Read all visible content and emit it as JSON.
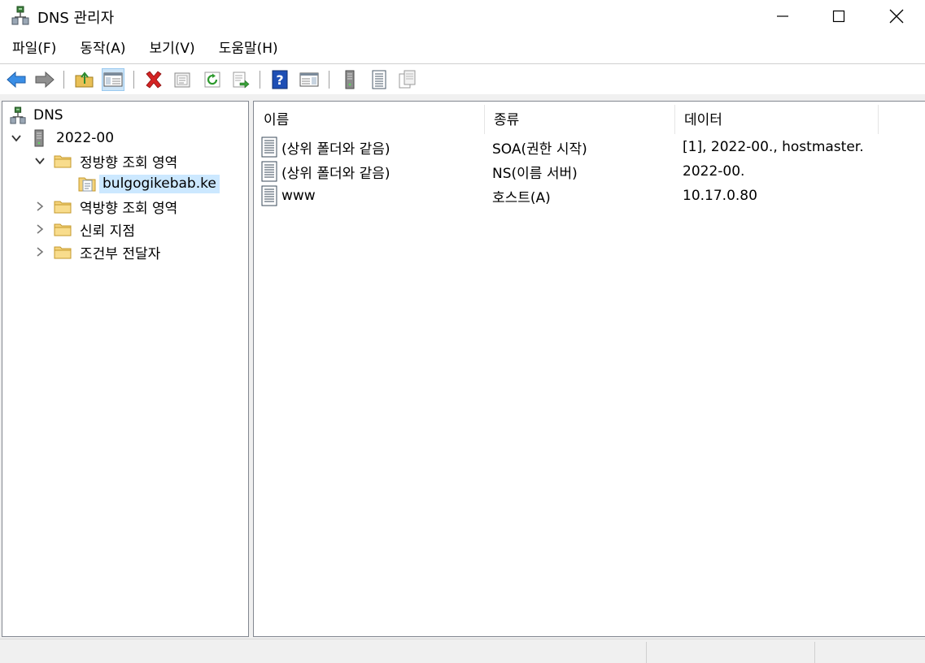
{
  "window": {
    "title": "DNS 관리자",
    "icon": "dns-server-icon"
  },
  "menu": [
    {
      "label": "파일(F)"
    },
    {
      "label": "동작(A)"
    },
    {
      "label": "보기(V)"
    },
    {
      "label": "도움말(H)"
    }
  ],
  "toolbar": {
    "buttons": [
      "back-arrow-icon",
      "forward-arrow-icon",
      "up-folder-icon",
      "show-hide-console-tree-icon",
      "delete-icon",
      "properties-icon",
      "refresh-icon",
      "export-list-icon",
      "help-icon",
      "action-pane-icon",
      "server-icon",
      "records-list-icon",
      "copy-records-icon"
    ]
  },
  "tree": {
    "root": "DNS",
    "server": "2022-00",
    "forward_zones": "정방향 조회 영역",
    "selected_zone": "bulgogikebab.ke",
    "reverse_zones": "역방향 조회 영역",
    "trust_points": "신뢰 지점",
    "conditional_forwarders": "조건부 전달자"
  },
  "list": {
    "columns": {
      "name": "이름",
      "type": "종류",
      "data": "데이터"
    },
    "rows": [
      {
        "name": "(상위 폴더와 같음)",
        "type": "SOA(권한 시작)",
        "data": "[1], 2022-00., hostmaster."
      },
      {
        "name": "(상위 폴더와 같음)",
        "type": "NS(이름 서버)",
        "data": "2022-00."
      },
      {
        "name": "www",
        "type": "호스트(A)",
        "data": "10.17.0.80"
      }
    ]
  },
  "colors": {
    "selection": "#cce8ff",
    "folder": "#f4d27a",
    "delete": "#d42424",
    "help": "#1e4fb5"
  }
}
